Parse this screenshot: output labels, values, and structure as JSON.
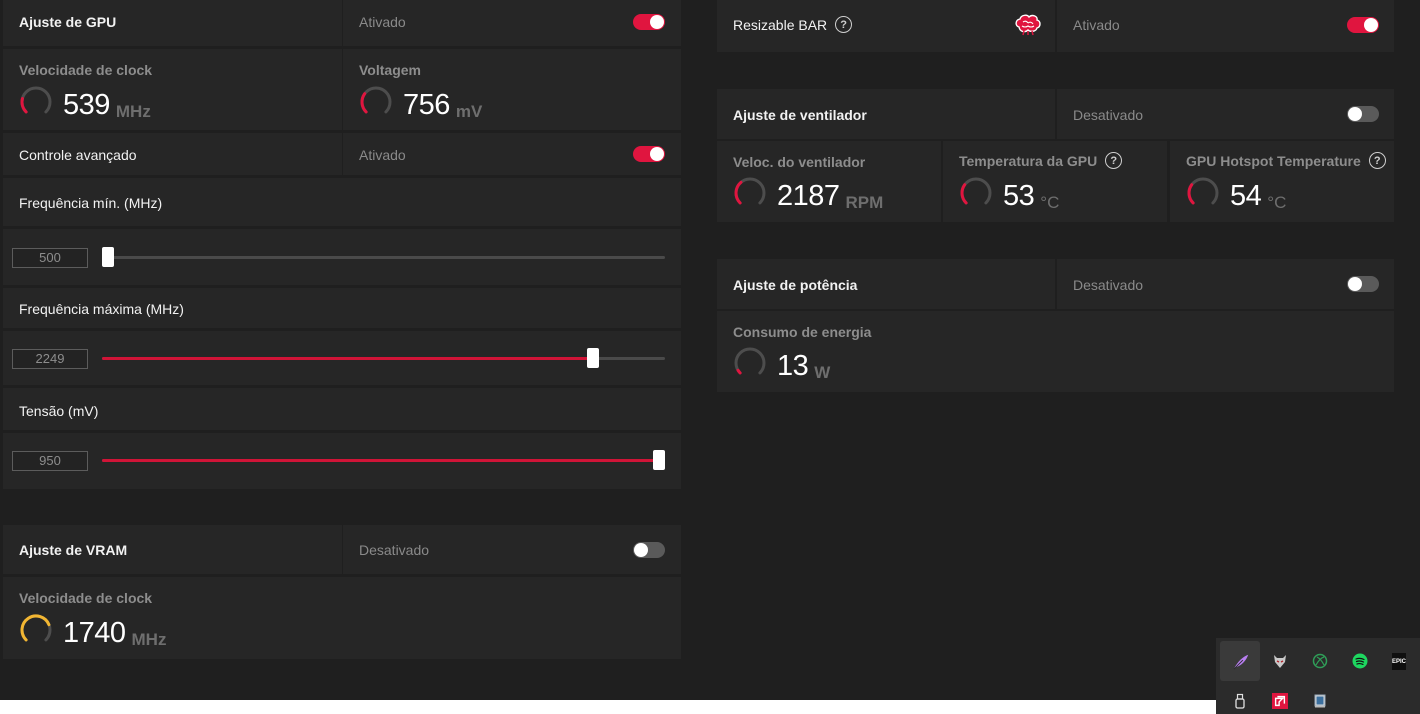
{
  "gpu_tuning": {
    "title": "Ajuste de GPU",
    "status": "Ativado",
    "clock": {
      "label": "Velocidade de clock",
      "value": "539",
      "unit": "MHz",
      "fraction": 0.22
    },
    "voltage": {
      "label": "Voltagem",
      "value": "756",
      "unit": "mV",
      "fraction": 0.3
    },
    "advanced": {
      "title": "Controle avançado",
      "status": "Ativado"
    },
    "min_freq": {
      "label": "Frequência mín. (MHz)",
      "value": "500",
      "fraction": 0.0
    },
    "max_freq": {
      "label": "Frequência máxima (MHz)",
      "value": "2249",
      "fraction": 0.88
    },
    "voltage_slider": {
      "label": "Tensão (mV)",
      "value": "950",
      "fraction": 1.0
    }
  },
  "vram_tuning": {
    "title": "Ajuste de VRAM",
    "status": "Desativado",
    "clock": {
      "label": "Velocidade de clock",
      "value": "1740",
      "unit": "MHz",
      "fraction": 0.75
    }
  },
  "resizable_bar": {
    "title": "Resizable BAR",
    "help": "?",
    "status": "Ativado"
  },
  "fan_tuning": {
    "title": "Ajuste de ventilador",
    "status": "Desativado",
    "fan_speed": {
      "label": "Veloc. do ventilador",
      "value": "2187",
      "unit": "RPM",
      "fraction": 0.35
    },
    "gpu_temp": {
      "label": "Temperatura da GPU",
      "value": "53",
      "unit": "°C",
      "fraction": 0.3
    },
    "hotspot_temp": {
      "label": "GPU Hotspot Temperature",
      "value": "54",
      "unit": "°C",
      "fraction": 0.3
    }
  },
  "power_tuning": {
    "title": "Ajuste de potência",
    "status": "Desativado",
    "consumption": {
      "label": "Consumo de energia",
      "value": "13",
      "unit": "W",
      "fraction": 0.05
    }
  },
  "colors": {
    "accent": "#e0153f",
    "vram_gauge": "#f2b632",
    "gauge_track": "#4d4d4d"
  },
  "tray_icons": [
    "feather-icon",
    "wolf-icon",
    "xbox-icon",
    "spotify-icon",
    "epic-games-icon",
    "usb-icon",
    "amd-icon",
    "monitor-icon"
  ],
  "tray_epic_text": "EPIC"
}
